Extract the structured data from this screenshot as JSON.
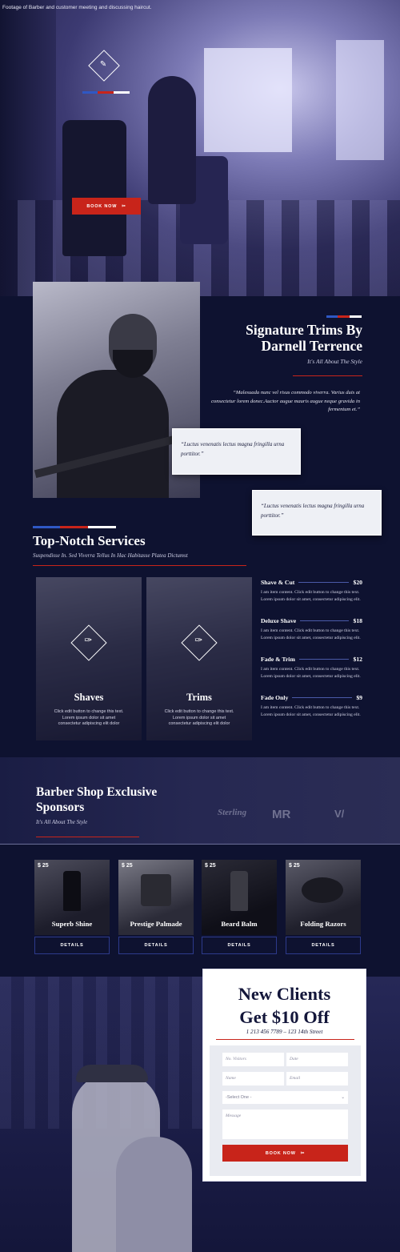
{
  "hero": {
    "caption": "Footage of Barber and customer meeting and discussing haircut.",
    "book_label": "BOOK NOW",
    "book_icon": "scissors-icon"
  },
  "colors": {
    "accent_red": "#c8241a",
    "accent_blue": "#2f58c4",
    "navy": "#0e1230"
  },
  "signature": {
    "title_line1": "Signature Trims By",
    "title_line2": "Darnell Terrence",
    "subtitle": "It's All About The Style",
    "quote": "“Malesuada nunc vel risus commodo viverra. Varius duis at consectetur lorem donec.Auctor augue mauris augue neque gravida in fermentum et.”",
    "card1": "“Luctus venenatis lectus magna fringilla urna porttitor.”",
    "card2": "“Luctus venenatis lectus magna fringilla urna porttitor.”"
  },
  "services": {
    "title": "Top-Notch Services",
    "subtitle": "Suspendisse In. Sed Viverra Tellus In Hac Habitasse Platea Dictumst",
    "tiles": [
      {
        "name": "Shaves",
        "desc": "Click edit button to change this text. Lorem ipsum dolor sit amet consectetur adipiscing elit dolor"
      },
      {
        "name": "Trims",
        "desc": "Click edit button to change this text. Lorem ipsum dolor sit amet consectetur adipiscing elit dolor"
      }
    ],
    "prices": [
      {
        "name": "Shave & Cut",
        "price": "$20",
        "desc": "I am item content. Click edit button to change this text. Lorem ipsum dolor sit amet, consectetur adipiscing elit."
      },
      {
        "name": "Deluxe Shave",
        "price": "$18",
        "desc": "I am item content. Click edit button to change this text. Lorem ipsum dolor sit amet, consectetur adipiscing elit."
      },
      {
        "name": "Fade & Trim",
        "price": "$12",
        "desc": "I am item content. Click edit button to change this text. Lorem ipsum dolor sit amet, consectetur adipiscing elit."
      },
      {
        "name": "Fade Only",
        "price": "$9",
        "desc": "I am item content. Click edit button to change this text. Lorem ipsum dolor sit amet, consectetur adipiscing elit."
      }
    ]
  },
  "sponsors": {
    "title_line1": "Barber Shop Exclusive",
    "title_line2": "Sponsors",
    "subtitle": "It's All About The Style",
    "logos": [
      "Sterling",
      "MR",
      "V/"
    ]
  },
  "products": [
    {
      "price": "$ 25",
      "name": "Superb Shine",
      "details": "DETAILS"
    },
    {
      "price": "$ 25",
      "name": "Prestige Palmade",
      "details": "DETAILS"
    },
    {
      "price": "$ 25",
      "name": "Beard Balm",
      "details": "DETAILS"
    },
    {
      "price": "$ 25",
      "name": "Folding Razors",
      "details": "DETAILS"
    }
  ],
  "new_clients": {
    "title_line1": "New Clients",
    "title_line2": "Get $10 Off",
    "phone": "1 213 456 7789 – 123 14th Street",
    "form": {
      "visitors_placeholder": "No. Visitors",
      "date_placeholder": "Date",
      "name_placeholder": "Name",
      "email_placeholder": "Email",
      "select_value": "-Select One -",
      "message_placeholder": "Message",
      "submit_label": "BOOK NOW"
    }
  }
}
